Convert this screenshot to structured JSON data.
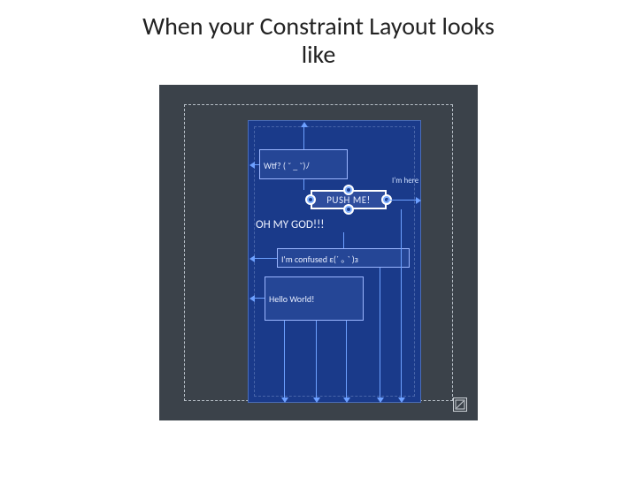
{
  "title_line1": "When your Constraint Layout looks",
  "title_line2": "like",
  "views": {
    "wtf": "Wtf? ( ˘ _ ˘)ﾉ",
    "push": "PUSH ME!",
    "im_here": "I'm here",
    "oh_my_god": "OH MY GOD!!!",
    "confused": "I'm confused  ε(´ ｡  ` )з",
    "hello": "Hello World!"
  },
  "toggle_no_view": "⧄"
}
